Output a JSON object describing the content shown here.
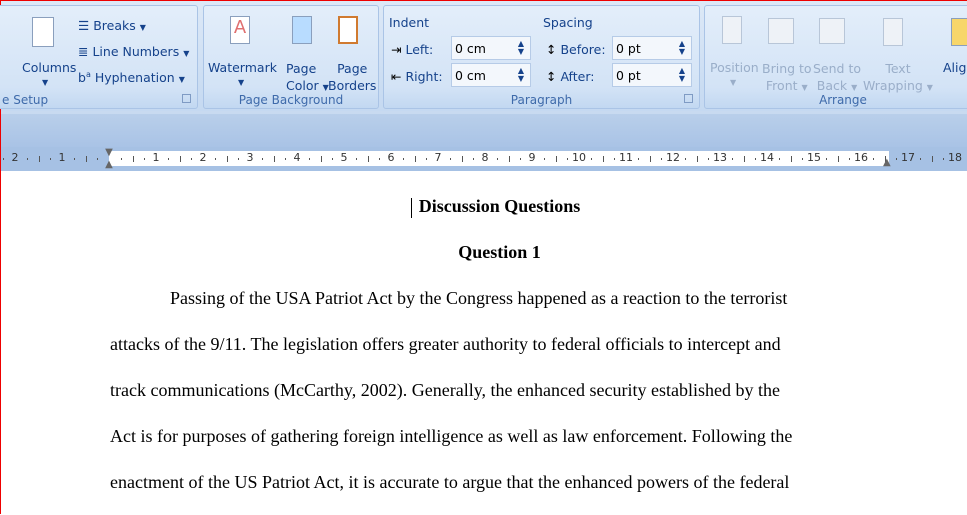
{
  "ribbon": {
    "page_setup": {
      "label": "e Setup",
      "columns": "Columns",
      "breaks": "Breaks",
      "line_numbers": "Line Numbers",
      "hyphenation": "Hyphenation"
    },
    "page_background": {
      "label": "Page Background",
      "watermark": "Watermark",
      "page_color": [
        "Page",
        "Color"
      ],
      "page_borders": [
        "Page",
        "Borders"
      ]
    },
    "paragraph": {
      "label": "Paragraph",
      "indent": "Indent",
      "spacing": "Spacing",
      "left_label": "Left:",
      "left_value": "0 cm",
      "right_label": "Right:",
      "right_value": "0 cm",
      "before_label": "Before:",
      "before_value": "0 pt",
      "after_label": "After:",
      "after_value": "0 pt"
    },
    "arrange": {
      "label": "Arrange",
      "position": "Position",
      "bring_front": [
        "Bring to",
        "Front"
      ],
      "send_back": [
        "Send to",
        "Back"
      ],
      "text_wrapping": [
        "Text",
        "Wrapping"
      ],
      "align": "Alig"
    }
  },
  "ruler": {
    "left_labels": [
      "2",
      "1"
    ],
    "labels": [
      "1",
      "2",
      "3",
      "4",
      "5",
      "6",
      "7",
      "8",
      "9",
      "10",
      "11",
      "12",
      "13",
      "14",
      "15",
      "16",
      "17",
      "18"
    ]
  },
  "document": {
    "title": "Discussion Questions",
    "heading": "Question 1",
    "lines": [
      "Passing of the USA Patriot Act by the Congress happened as a reaction to the terrorist",
      "attacks of the 9/11. The legislation offers greater authority to federal officials to intercept and",
      "track communications (McCarthy, 2002). Generally, the enhanced security established by the",
      "Act is for purposes of gathering foreign intelligence as well as law enforcement. Following the",
      "enactment of the US Patriot Act, it is accurate to argue that the enhanced powers of the federal"
    ]
  }
}
